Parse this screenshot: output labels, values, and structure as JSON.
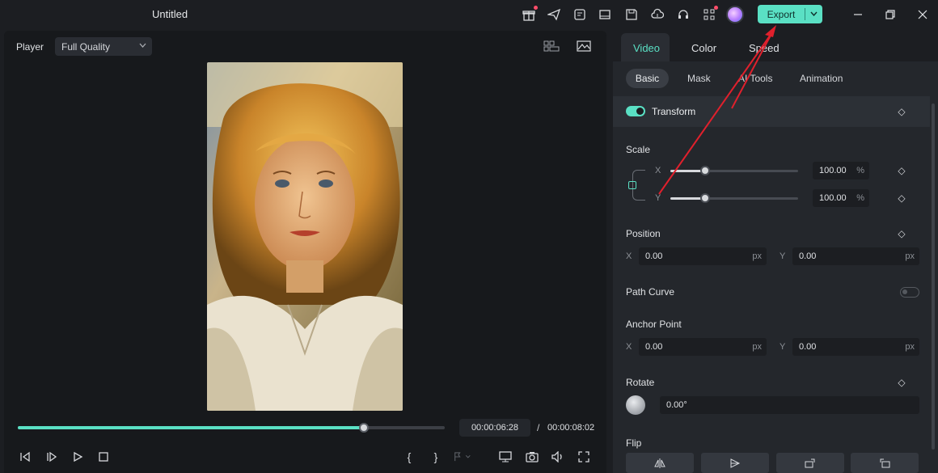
{
  "app": {
    "title": "Untitled"
  },
  "toolbar": {
    "icons": [
      "gift-icon",
      "send-icon",
      "task-icon",
      "layout-icon",
      "save-icon",
      "cloud-upload-icon",
      "headset-icon",
      "apps-icon"
    ],
    "export_label": "Export"
  },
  "player": {
    "label": "Player",
    "quality": "Full Quality",
    "current_time": "00:00:06:28",
    "separator": "/",
    "total_time": "00:00:08:02",
    "progress": 0.81
  },
  "panel": {
    "tabs": [
      "Video",
      "Color",
      "Speed"
    ],
    "active_tab": "Video",
    "sub_tabs": [
      "Basic",
      "Mask",
      "AI Tools",
      "Animation"
    ],
    "active_sub_tab": "Basic",
    "transform": {
      "label": "Transform",
      "enabled": true,
      "scale": {
        "label": "Scale",
        "x_axis": "X",
        "x_value": "100.00",
        "x_unit": "%",
        "x_slider": 0.27,
        "y_axis": "Y",
        "y_value": "100.00",
        "y_unit": "%",
        "y_slider": 0.27
      },
      "position": {
        "label": "Position",
        "x_axis": "X",
        "x_value": "0.00",
        "x_unit": "px",
        "y_axis": "Y",
        "y_value": "0.00",
        "y_unit": "px"
      },
      "path_curve": {
        "label": "Path Curve",
        "enabled": false
      },
      "anchor_point": {
        "label": "Anchor Point",
        "x_axis": "X",
        "x_value": "0.00",
        "x_unit": "px",
        "y_axis": "Y",
        "y_value": "0.00",
        "y_unit": "px"
      },
      "rotate": {
        "label": "Rotate",
        "value": "0.00°"
      },
      "flip": {
        "label": "Flip"
      }
    }
  },
  "colors": {
    "accent": "#5ae0c4",
    "annotation_arrow": "#e0202c"
  }
}
